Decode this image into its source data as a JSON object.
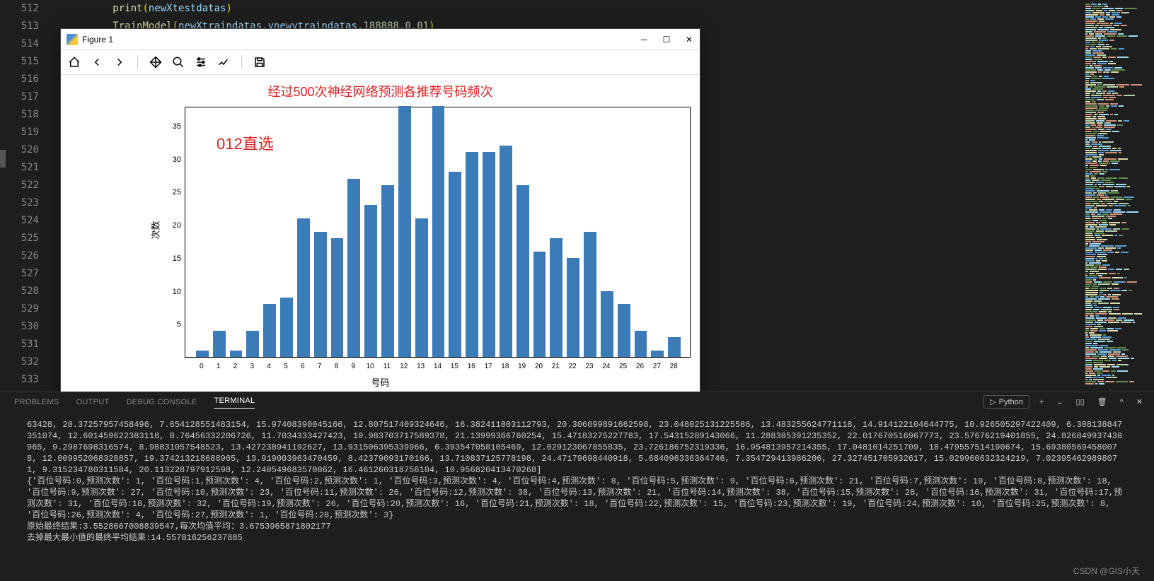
{
  "editor": {
    "lines_start": 512,
    "lines_end": 533,
    "code": [
      {
        "indent": "          ",
        "parts": [
          {
            "cls": "kw-print",
            "t": "print"
          },
          {
            "cls": "paren",
            "t": "("
          },
          {
            "cls": "var",
            "t": "newXtestdatas"
          },
          {
            "cls": "paren",
            "t": ")"
          }
        ]
      },
      {
        "indent": "          ",
        "parts": [
          {
            "cls": "fn",
            "t": "TrainModel"
          },
          {
            "cls": "paren",
            "t": "("
          },
          {
            "cls": "var",
            "t": "newXtraindatas"
          },
          {
            "cls": "comma",
            "t": ","
          },
          {
            "cls": "var",
            "t": "ynewytraindatas"
          },
          {
            "cls": "comma",
            "t": ","
          },
          {
            "cls": "num",
            "t": "188888"
          },
          {
            "cls": "comma",
            "t": ","
          },
          {
            "cls": "num",
            "t": "0.01"
          },
          {
            "cls": "paren",
            "t": ")"
          }
        ]
      }
    ]
  },
  "figure": {
    "window_title": "Figure 1",
    "toolbar": [
      "home",
      "back",
      "forward",
      "pan",
      "zoom",
      "configure",
      "lineplot",
      "save"
    ]
  },
  "chart_data": {
    "type": "bar",
    "title": "经过500次神经网络预测各推荐号码频次",
    "annotation": "012直选",
    "xlabel": "号码",
    "ylabel": "次数",
    "ylim": [
      0,
      38
    ],
    "yticks": [
      5,
      10,
      15,
      20,
      25,
      30,
      35
    ],
    "categories": [
      "0",
      "1",
      "2",
      "3",
      "4",
      "5",
      "6",
      "7",
      "8",
      "9",
      "10",
      "11",
      "12",
      "13",
      "14",
      "15",
      "16",
      "17",
      "18",
      "19",
      "20",
      "21",
      "22",
      "23",
      "24",
      "25",
      "26",
      "27",
      "28"
    ],
    "values": [
      1,
      4,
      1,
      4,
      8,
      9,
      21,
      19,
      18,
      27,
      23,
      26,
      38,
      21,
      38,
      28,
      31,
      31,
      32,
      26,
      16,
      18,
      15,
      19,
      10,
      8,
      4,
      1,
      3
    ]
  },
  "panel": {
    "tabs": [
      {
        "label": "PROBLEMS",
        "active": false
      },
      {
        "label": "OUTPUT",
        "active": false
      },
      {
        "label": "DEBUG CONSOLE",
        "active": false
      },
      {
        "label": "TERMINAL",
        "active": true
      }
    ],
    "shell_label": "Python",
    "output_lines": [
      "63428, 20.37257957458496, 7.654128551483154, 15.97408390045166, 12.807517409324646, 16.382411003112793, 20.306099891662598, 23.048025131225586, 13.483255624771118, 14.914122104644775, 10.926505297422409, 6.308138847351074, 12.601459622383118, 8.76456332206726, 11.7034333427423, 10.983703717589378, 21.13999366760254, 15.47183275227783, 17.54315289143066, 11.288385391235352, 22.017670516967773, 23.57676219401855, 24.826849937438965, 9.2987698316574, 8.98831057548523, 13.427238941192627, 13.931506395339966, 6.393547058105469, 12.029123067855835, 23.726186752319336, 16.954813957214355, 17.0481014251709, 18.479557514190674, 15.693805694580078, 12.009952068328857, 19.374213218688965, 13.919003963470459, 8.42379093170166, 13.710837125778198, 24.47179698440918, 5.684096336364746, 7.354729413986206, 27.327451705932617, 15.029960632324219, 7.023954629898071, 9.315234780311584, 20.113228797912598, 12.240549683570862, 16.461260318756104, 10.956820413470268]",
      "{'百位号码:0,预测次数': 1, '百位号码:1,预测次数': 4, '百位号码:2,预测次数': 1, '百位号码:3,预测次数': 4, '百位号码:4,预测次数': 8, '百位号码:5,预测次数': 9, '百位号码:6,预测次数': 21, '百位号码:7,预测次数': 19, '百位号码:8,预测次数': 18, '百位号码:9,预测次数': 27, '百位号码:10,预测次数': 23, '百位号码:11,预测次数': 26, '百位号码:12,预测次数': 38, '百位号码:13,预测次数': 21, '百位号码:14,预测次数': 38, '百位号码:15,预测次数': 28, '百位号码:16,预测次数': 31, '百位号码:17,预测次数': 31, '百位号码:18,预测次数': 32, '百位号码:19,预测次数': 26, '百位号码:20,预测次数': 16, '百位号码:21,预测次数': 18, '百位号码:22,预测次数': 15, '百位号码:23,预测次数': 19, '百位号码:24,预测次数': 10, '百位号码:25,预测次数': 8, '百位号码:26,预测次数': 4, '百位号码:27,预测次数': 1, '百位号码:28,预测次数': 3}",
      "原始最终结果:3.5528667008839547,每次均值平均：3.6753965871802177",
      "去掉最大最小值的最终平均结果:14.557816256237885"
    ]
  },
  "watermark": "CSDN @GIS小天"
}
